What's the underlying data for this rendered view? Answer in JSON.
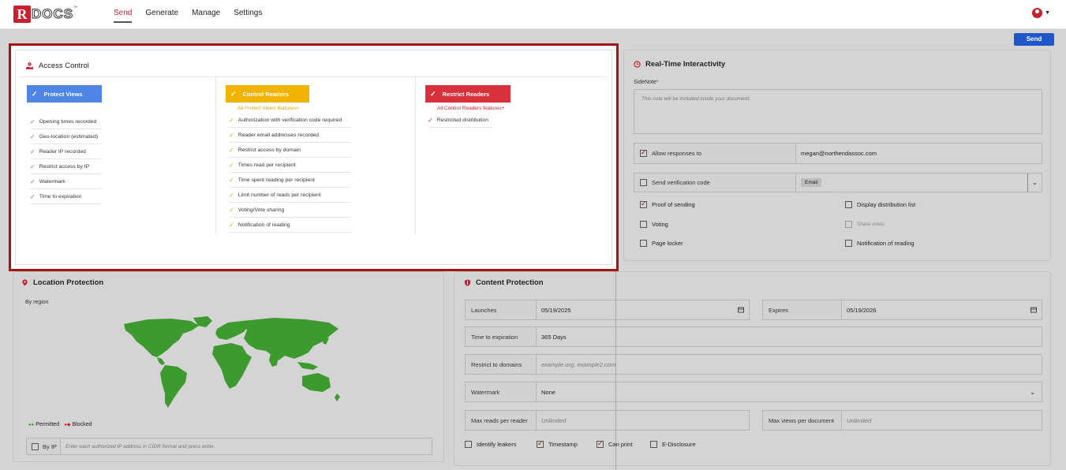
{
  "app": {
    "logo_letter": "R",
    "logo_text": "DOCS",
    "logo_tm": "™"
  },
  "nav": {
    "items": [
      "Send",
      "Generate",
      "Manage",
      "Settings"
    ],
    "active": "Send"
  },
  "toolbar": {
    "send_label": "Send"
  },
  "access_control": {
    "title": "Access Control",
    "tiers": [
      {
        "label": "Protect Views",
        "color": "#4f86e6",
        "subtitle": "",
        "features": [
          "Opening times recorded",
          "Geo-location (estimated)",
          "Reader IP recorded",
          "Restrict access by IP",
          "Watermark",
          "Time to expiration"
        ]
      },
      {
        "label": "Control Readers",
        "color": "#f0b400",
        "subtitle": "All Protect Views features+",
        "features": [
          "Authorization with verification code required",
          "Reader email addresses recorded",
          "Restrict access by domain",
          "Times read per recipient",
          "Time spent reading per recipient",
          "Limit number of reads per recipient",
          "Voting/Vote sharing",
          "Notification of reading"
        ]
      },
      {
        "label": "Restrict Readers",
        "color": "#d8313c",
        "subtitle": "All Control Readers features+",
        "features": [
          "Restricted distribution"
        ]
      }
    ]
  },
  "realtime": {
    "title": "Real-Time Interactivity",
    "sidenote_label": "SideNote",
    "sidenote_required": "*",
    "sidenote_placeholder": "This note will be included inside your document.",
    "allow_responses_label": "Allow responses to",
    "allow_responses_checked": true,
    "allow_responses_value": "megan@northendassoc.com",
    "verification_label": "Send verification code",
    "verification_checked": false,
    "verification_method": "Email",
    "options": {
      "proof_of_sending": "Proof of sending",
      "display_distribution": "Display distribution list",
      "voting": "Voting",
      "share_votes": "Share votes",
      "page_locker": "Page locker",
      "notification_of_reading": "Notification of reading"
    }
  },
  "location": {
    "title": "Location Protection",
    "by_region": "By region",
    "legend_permitted": "Permitted",
    "legend_blocked": "Blocked",
    "by_ip_label": "By IP",
    "ip_placeholder": "Enter each authorized IP address in CIDR format and press enter.",
    "map_color": "#3c9a2e"
  },
  "content": {
    "title": "Content Protection",
    "launches_label": "Launches",
    "launches_value": "05/19/2025",
    "expires_label": "Expires",
    "expires_value": "05/19/2026",
    "tte_label": "Time to expiration",
    "tte_value": "365 Days",
    "domains_label": "Restrict to domains",
    "domains_placeholder": "example.org, example2.com",
    "watermark_label": "Watermark",
    "watermark_value": "None",
    "max_reads_label": "Max reads per reader",
    "max_reads_value": "Unlimited",
    "max_views_label": "Max views per document",
    "max_views_value": "Unlimited",
    "checks": [
      {
        "label": "Identify leakers",
        "checked": false
      },
      {
        "label": "Timestamp",
        "checked": true
      },
      {
        "label": "Can print",
        "checked": true
      },
      {
        "label": "E-Disclosure",
        "checked": false
      }
    ]
  }
}
